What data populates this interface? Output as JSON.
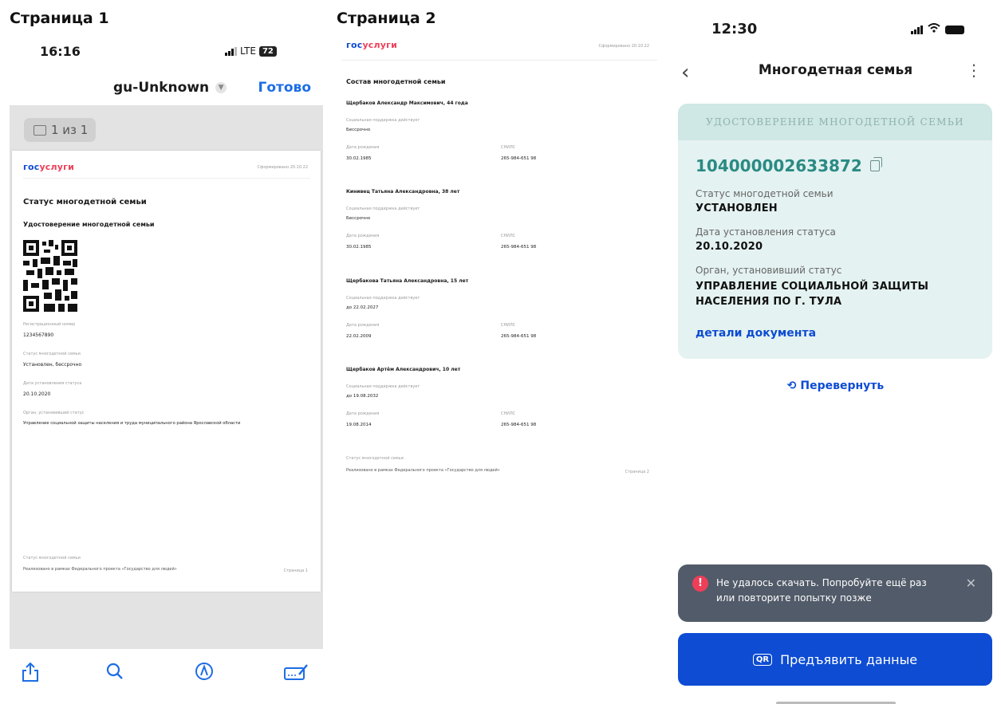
{
  "labels": {
    "page1": "Страница 1",
    "page2": "Страница 2"
  },
  "colors": {
    "accent_blue": "#0d4cd3",
    "brand_red": "#ee3f58",
    "card_teal": "#e4f2f1",
    "toast_bg": "#525b69"
  },
  "page1": {
    "status": {
      "time": "16:16",
      "network": "LTE",
      "battery": "72"
    },
    "nav": {
      "filename": "gu-Unknown",
      "done": "Готово"
    },
    "page_badge": "1 из 1",
    "doc": {
      "logo_a": "гос",
      "logo_b": "услуги",
      "generated": "Сформировано 20.10.22",
      "title": "Статус многодетной семьи",
      "subtitle": "Удостоверение многодетной семьи",
      "fields": [
        {
          "label": "Регистрационный номер",
          "value": "1234567890"
        },
        {
          "label": "Статус многодетной семьи",
          "value": "Установлен, бессрочно"
        },
        {
          "label": "Дата установления статуса",
          "value": "20.10.2020"
        },
        {
          "label": "Орган, установивший статус",
          "value": "Управление социальной защиты населения и труда муниципального района Ярославской области"
        }
      ],
      "footer_label": "Статус многодетной семьи",
      "footer_text": "Реализовано в рамках Федерального проекта «Государство для людей»",
      "footer_page": "Страница 1"
    },
    "toolbar": {
      "share": "share-icon",
      "search": "search-icon",
      "markup": "markup-icon",
      "sign": "signature-icon"
    }
  },
  "page2": {
    "logo_a": "гос",
    "logo_b": "услуги",
    "generated": "Сформировано 20.10.22",
    "title": "Состав многодетной семьи",
    "members": [
      {
        "name": "Щербаков Александр Максимович, 44 года",
        "support_label": "Социальная поддержка действует",
        "support": "Бессрочно",
        "dob_label": "Дата рождения",
        "dob": "30.02.1985",
        "snils_label": "СНИЛС",
        "snils": "265-984-651 98"
      },
      {
        "name": "Кинивец Татьяна Александровна, 38 лет",
        "support_label": "Социальная поддержка действует",
        "support": "Бессрочно",
        "dob_label": "Дата рождения",
        "dob": "30.02.1985",
        "snils_label": "СНИЛС",
        "snils": "265-984-651 98"
      },
      {
        "name": "Щербакова Татьяна Александровна, 15 лет",
        "support_label": "Социальная поддержка действует",
        "support": "до 22.02.2027",
        "dob_label": "Дата рождения",
        "dob": "22.02.2009",
        "snils_label": "СНИЛС",
        "snils": "265-984-651 98"
      },
      {
        "name": "Щербаков Артём Александрович, 10 лет",
        "support_label": "Социальная поддержка действует",
        "support": "до 19.08.2032",
        "dob_label": "Дата рождения",
        "dob": "19.08.2014",
        "snils_label": "СНИЛС",
        "snils": "265-984-651 98"
      }
    ],
    "footer_label": "Статус многодетной семьи",
    "footer_text": "Реализовано в рамках Федерального проекта «Государство для людей»",
    "footer_page": "Страница 2"
  },
  "app": {
    "status": {
      "time": "12:30"
    },
    "title": "Многодетная семья",
    "card_header": "УДОСТОВЕРЕНИЕ МНОГОДЕТНОЙ СЕМЬИ",
    "number": "104000002633872",
    "fields": [
      {
        "label": "Статус многодетной семьи",
        "value": "УСТАНОВЛЕН"
      },
      {
        "label": "Дата установления статуса",
        "value": "20.10.2020"
      },
      {
        "label": "Орган, установивший статус",
        "value": "УПРАВЛЕНИЕ СОЦИАЛЬНОЙ ЗАЩИТЫ НАСЕЛЕНИЯ ПО Г. ТУЛА"
      }
    ],
    "details_link": "детали документа",
    "flip": "Перевернуть",
    "toast": "Не удалось скачать. Попробуйте ещё раз или повторите попытку позже",
    "present_button": "Предъявить данные",
    "qr_icon_text": "QR"
  }
}
